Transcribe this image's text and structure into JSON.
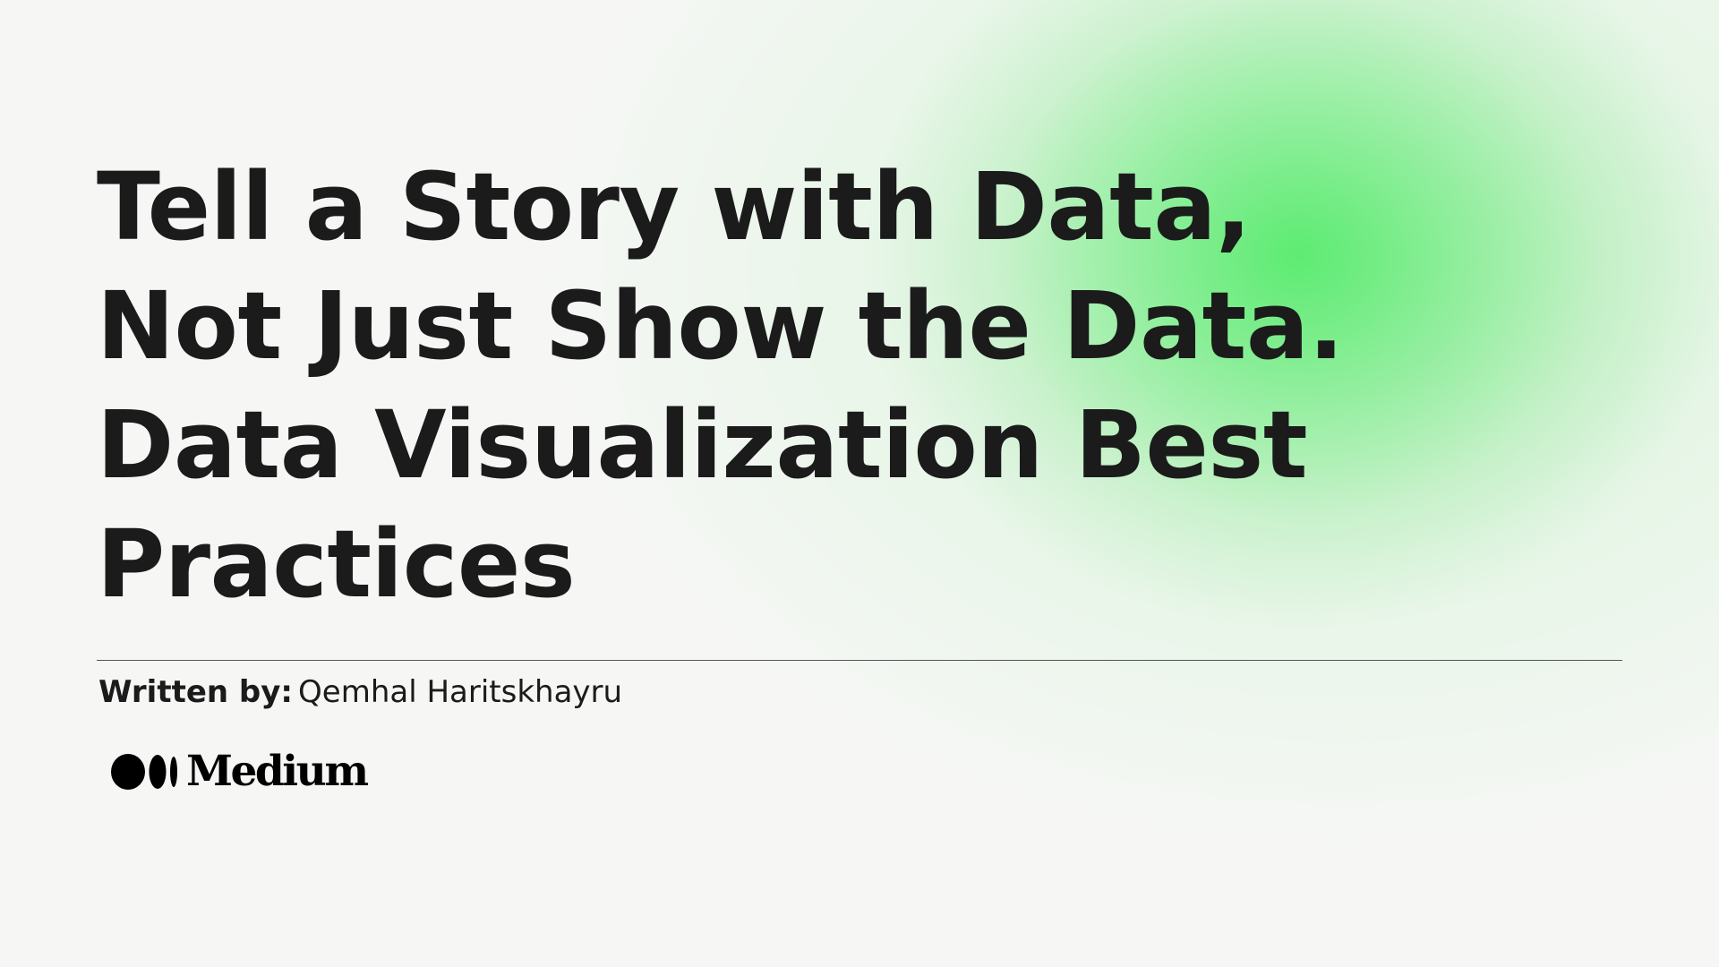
{
  "title": {
    "lines": [
      "Tell a Story with Data,",
      "Not Just Show the Data.",
      "Data Visualization Best",
      "Practices"
    ]
  },
  "byline": {
    "label": "Written by:",
    "author": "Qemhal Haritskhayru"
  },
  "brand": {
    "logo_icon": "medium-logo-icon",
    "name": "Medium"
  },
  "colors": {
    "background": "#f6f7f5",
    "accent_glow": "#58eb6e",
    "text": "#1b1b1b"
  }
}
